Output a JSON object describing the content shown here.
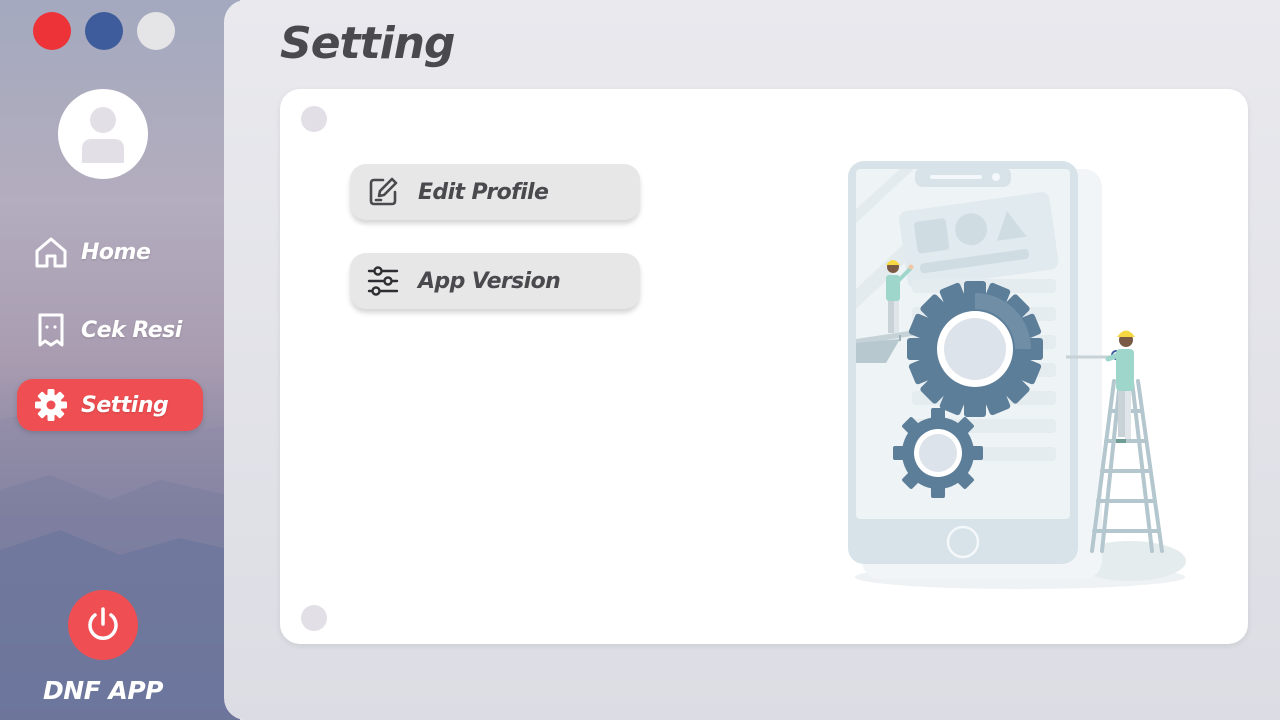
{
  "window_controls": [
    {
      "name": "close",
      "color": "#ee3338"
    },
    {
      "name": "minimize",
      "color": "#3e5b9c"
    },
    {
      "name": "maximize",
      "color": "#e5e5e8"
    }
  ],
  "sidebar": {
    "avatar_icon": "user-icon",
    "items": [
      {
        "label": "Home",
        "icon": "home-icon",
        "active": false
      },
      {
        "label": "Cek Resi",
        "icon": "receipt-icon",
        "active": false
      },
      {
        "label": "Setting",
        "icon": "gear-icon",
        "active": true
      }
    ],
    "power_icon": "power-icon",
    "app_name": "DNF APP"
  },
  "main": {
    "title": "Setting",
    "menu": [
      {
        "label": "Edit Profile",
        "icon": "edit-icon"
      },
      {
        "label": "App Version",
        "icon": "sliders-icon"
      }
    ],
    "illustration": "phone-settings-gears-workers"
  },
  "colors": {
    "accent": "#ef4f52",
    "title_text": "#4a4a4e",
    "card": "#ffffff",
    "button_bg": "#e7e7e7"
  }
}
